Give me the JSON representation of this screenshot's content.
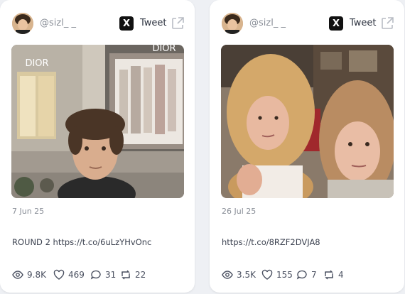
{
  "tweets": [
    {
      "handle": "@sizl_ _",
      "tweet_label": "Tweet",
      "date": "7 Jun 25",
      "text": "ROUND 2 https://t.co/6uLzYHvOnc",
      "photo_sign_left": "DIOR",
      "photo_sign_right": "DIOR",
      "stats": {
        "views": "9.8K",
        "likes": "469",
        "replies": "31",
        "retweets": "22"
      }
    },
    {
      "handle": "@sizl_ _",
      "tweet_label": "Tweet",
      "date": "26 Jul 25",
      "text": "https://t.co/8RZF2DVJA8",
      "stats": {
        "views": "3.5K",
        "likes": "155",
        "replies": "7",
        "retweets": "4"
      }
    }
  ],
  "icons": {
    "x_logo": "X",
    "external_link": "external-link-icon",
    "views": "eye-icon",
    "likes": "heart-icon",
    "replies": "comment-icon",
    "retweets": "retweet-icon"
  }
}
